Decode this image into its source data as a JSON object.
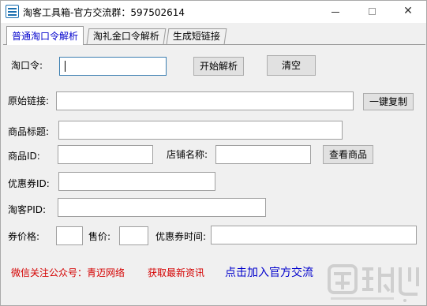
{
  "window": {
    "title": "淘客工具箱-官方交流群：597502614",
    "minimize_label": "",
    "close_label": "✕"
  },
  "tabs": [
    {
      "label": "普通淘口令解析",
      "active": true
    },
    {
      "label": "淘礼金口令解析",
      "active": false
    },
    {
      "label": "生成短链接",
      "active": false
    }
  ],
  "form": {
    "taokouling_label": "淘口令:",
    "taokouling_value": "",
    "parse_button": "开始解析",
    "clear_button": "清空",
    "original_link_label": "原始链接:",
    "original_link_value": "",
    "copy_button": "一键复制",
    "product_title_label": "商品标题:",
    "product_title_value": "",
    "product_id_label": "商品ID:",
    "product_id_value": "",
    "shop_name_label": "店铺名称:",
    "shop_name_value": "",
    "view_product_button": "查看商品",
    "coupon_id_label": "优惠券ID:",
    "coupon_id_value": "",
    "taoke_pid_label": "淘客PID:",
    "taoke_pid_value": "",
    "coupon_price_label": "券价格:",
    "coupon_price_value": "",
    "sale_price_label": "售价:",
    "sale_price_value": "",
    "coupon_time_label": "优惠券时间:",
    "coupon_time_value": ""
  },
  "footer": {
    "wechat_text": "微信关注公众号：青迈网络",
    "news_text": "获取最新资讯",
    "join_text": "点击加入官方交流"
  },
  "colors": {
    "accent_blue": "#0000cc",
    "footer_red": "#d40000",
    "focus_border": "#3c7fb1"
  }
}
